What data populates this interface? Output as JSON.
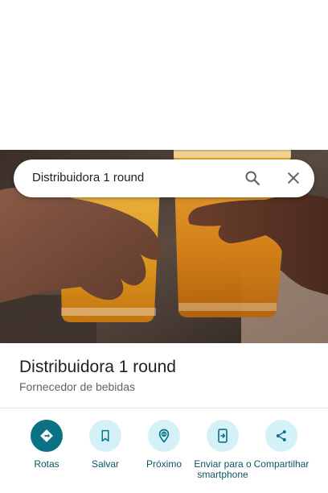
{
  "search": {
    "query": "Distribuidora 1 round"
  },
  "place": {
    "name": "Distribuidora 1 round",
    "category": "Fornecedor de bebidas"
  },
  "actions": [
    {
      "label": "Rotas",
      "icon": "directions-icon"
    },
    {
      "label": "Salvar",
      "icon": "bookmark-icon"
    },
    {
      "label": "Próximo",
      "icon": "nearby-icon"
    },
    {
      "label": "Enviar para o smartphone",
      "icon": "send-to-phone-icon"
    },
    {
      "label": "Compartilhar",
      "icon": "share-icon"
    }
  ],
  "colors": {
    "accent": "#0b7285",
    "action_circle": "#d4f1f7",
    "action_label": "#0b5563"
  }
}
